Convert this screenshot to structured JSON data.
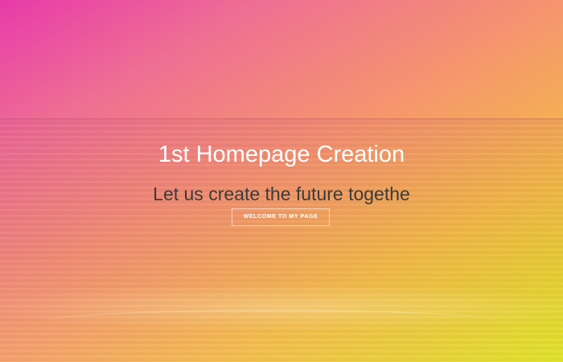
{
  "hero": {
    "title": "1st Homepage Creation",
    "subtitle": "Let us create the future togethe",
    "cta_label": "WELCOME TO MY PAGE",
    "gradient_colors": [
      "#e83aaa",
      "#ee6f93",
      "#f5956e",
      "#f4bb46",
      "#dfe21f"
    ],
    "title_color": "#ffffff",
    "subtitle_color": "#3b3b3b"
  }
}
